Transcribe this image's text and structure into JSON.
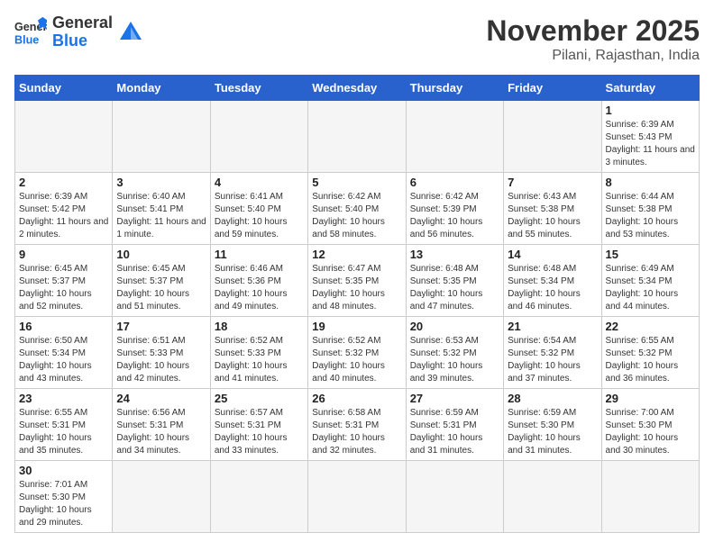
{
  "header": {
    "logo_general": "General",
    "logo_blue": "Blue",
    "month_title": "November 2025",
    "location": "Pilani, Rajasthan, India"
  },
  "weekdays": [
    "Sunday",
    "Monday",
    "Tuesday",
    "Wednesday",
    "Thursday",
    "Friday",
    "Saturday"
  ],
  "weeks": [
    [
      {
        "day": "",
        "info": ""
      },
      {
        "day": "",
        "info": ""
      },
      {
        "day": "",
        "info": ""
      },
      {
        "day": "",
        "info": ""
      },
      {
        "day": "",
        "info": ""
      },
      {
        "day": "",
        "info": ""
      },
      {
        "day": "1",
        "info": "Sunrise: 6:39 AM\nSunset: 5:43 PM\nDaylight: 11 hours and 3 minutes."
      }
    ],
    [
      {
        "day": "2",
        "info": "Sunrise: 6:39 AM\nSunset: 5:42 PM\nDaylight: 11 hours and 2 minutes."
      },
      {
        "day": "3",
        "info": "Sunrise: 6:40 AM\nSunset: 5:41 PM\nDaylight: 11 hours and 1 minute."
      },
      {
        "day": "4",
        "info": "Sunrise: 6:41 AM\nSunset: 5:40 PM\nDaylight: 10 hours and 59 minutes."
      },
      {
        "day": "5",
        "info": "Sunrise: 6:42 AM\nSunset: 5:40 PM\nDaylight: 10 hours and 58 minutes."
      },
      {
        "day": "6",
        "info": "Sunrise: 6:42 AM\nSunset: 5:39 PM\nDaylight: 10 hours and 56 minutes."
      },
      {
        "day": "7",
        "info": "Sunrise: 6:43 AM\nSunset: 5:38 PM\nDaylight: 10 hours and 55 minutes."
      },
      {
        "day": "8",
        "info": "Sunrise: 6:44 AM\nSunset: 5:38 PM\nDaylight: 10 hours and 53 minutes."
      }
    ],
    [
      {
        "day": "9",
        "info": "Sunrise: 6:45 AM\nSunset: 5:37 PM\nDaylight: 10 hours and 52 minutes."
      },
      {
        "day": "10",
        "info": "Sunrise: 6:45 AM\nSunset: 5:37 PM\nDaylight: 10 hours and 51 minutes."
      },
      {
        "day": "11",
        "info": "Sunrise: 6:46 AM\nSunset: 5:36 PM\nDaylight: 10 hours and 49 minutes."
      },
      {
        "day": "12",
        "info": "Sunrise: 6:47 AM\nSunset: 5:35 PM\nDaylight: 10 hours and 48 minutes."
      },
      {
        "day": "13",
        "info": "Sunrise: 6:48 AM\nSunset: 5:35 PM\nDaylight: 10 hours and 47 minutes."
      },
      {
        "day": "14",
        "info": "Sunrise: 6:48 AM\nSunset: 5:34 PM\nDaylight: 10 hours and 46 minutes."
      },
      {
        "day": "15",
        "info": "Sunrise: 6:49 AM\nSunset: 5:34 PM\nDaylight: 10 hours and 44 minutes."
      }
    ],
    [
      {
        "day": "16",
        "info": "Sunrise: 6:50 AM\nSunset: 5:34 PM\nDaylight: 10 hours and 43 minutes."
      },
      {
        "day": "17",
        "info": "Sunrise: 6:51 AM\nSunset: 5:33 PM\nDaylight: 10 hours and 42 minutes."
      },
      {
        "day": "18",
        "info": "Sunrise: 6:52 AM\nSunset: 5:33 PM\nDaylight: 10 hours and 41 minutes."
      },
      {
        "day": "19",
        "info": "Sunrise: 6:52 AM\nSunset: 5:32 PM\nDaylight: 10 hours and 40 minutes."
      },
      {
        "day": "20",
        "info": "Sunrise: 6:53 AM\nSunset: 5:32 PM\nDaylight: 10 hours and 39 minutes."
      },
      {
        "day": "21",
        "info": "Sunrise: 6:54 AM\nSunset: 5:32 PM\nDaylight: 10 hours and 37 minutes."
      },
      {
        "day": "22",
        "info": "Sunrise: 6:55 AM\nSunset: 5:32 PM\nDaylight: 10 hours and 36 minutes."
      }
    ],
    [
      {
        "day": "23",
        "info": "Sunrise: 6:55 AM\nSunset: 5:31 PM\nDaylight: 10 hours and 35 minutes."
      },
      {
        "day": "24",
        "info": "Sunrise: 6:56 AM\nSunset: 5:31 PM\nDaylight: 10 hours and 34 minutes."
      },
      {
        "day": "25",
        "info": "Sunrise: 6:57 AM\nSunset: 5:31 PM\nDaylight: 10 hours and 33 minutes."
      },
      {
        "day": "26",
        "info": "Sunrise: 6:58 AM\nSunset: 5:31 PM\nDaylight: 10 hours and 32 minutes."
      },
      {
        "day": "27",
        "info": "Sunrise: 6:59 AM\nSunset: 5:31 PM\nDaylight: 10 hours and 31 minutes."
      },
      {
        "day": "28",
        "info": "Sunrise: 6:59 AM\nSunset: 5:30 PM\nDaylight: 10 hours and 31 minutes."
      },
      {
        "day": "29",
        "info": "Sunrise: 7:00 AM\nSunset: 5:30 PM\nDaylight: 10 hours and 30 minutes."
      }
    ],
    [
      {
        "day": "30",
        "info": "Sunrise: 7:01 AM\nSunset: 5:30 PM\nDaylight: 10 hours and 29 minutes."
      },
      {
        "day": "",
        "info": ""
      },
      {
        "day": "",
        "info": ""
      },
      {
        "day": "",
        "info": ""
      },
      {
        "day": "",
        "info": ""
      },
      {
        "day": "",
        "info": ""
      },
      {
        "day": "",
        "info": ""
      }
    ]
  ]
}
